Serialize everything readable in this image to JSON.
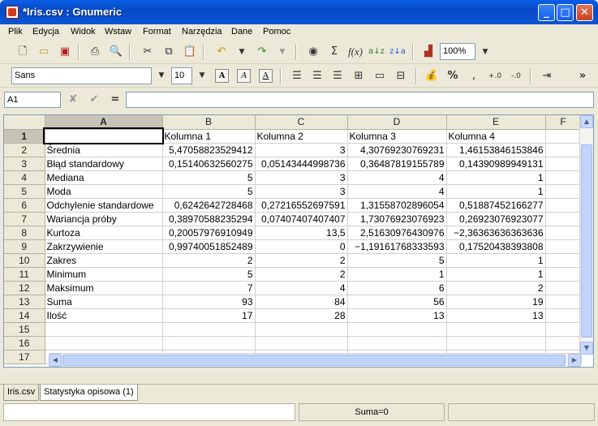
{
  "window": {
    "title": "*Iris.csv : Gnumeric"
  },
  "menu": [
    "Plik",
    "Edycja",
    "Widok",
    "Wstaw",
    "Format",
    "Narzędzia",
    "Dane",
    "Pomoc"
  ],
  "toolbar": {
    "zoom": "100%",
    "font_name": "Sans",
    "font_size": "10",
    "bold_A": "A",
    "italic_A": "A",
    "underline_A": "A",
    "percent": "%",
    "chevron": "»"
  },
  "entry": {
    "cell_ref": "A1",
    "equals": "=",
    "value": ""
  },
  "columns": [
    "A",
    "B",
    "C",
    "D",
    "E",
    "F"
  ],
  "rows": [
    {
      "n": "1",
      "a": "",
      "b": "Kolumna 1",
      "c": "Kolumna 2",
      "d": "Kolumna 3",
      "e": "Kolumna 4"
    },
    {
      "n": "2",
      "a": "Średnia",
      "b": "5,47058823529412",
      "c": "3",
      "d": "4,30769230769231",
      "e": "1,46153846153846"
    },
    {
      "n": "3",
      "a": "Błąd standardowy",
      "b": "0,15140632560275",
      "c": "0,05143444998736",
      "d": "0,36487819155789",
      "e": "0,14390989949131"
    },
    {
      "n": "4",
      "a": "Mediana",
      "b": "5",
      "c": "3",
      "d": "4",
      "e": "1"
    },
    {
      "n": "5",
      "a": "Moda",
      "b": "5",
      "c": "3",
      "d": "4",
      "e": "1"
    },
    {
      "n": "6",
      "a": "Odchylenie standardowe",
      "b": "0,6242642728468",
      "c": "0,27216552697591",
      "d": "1,31558702896054",
      "e": "0,51887452166277"
    },
    {
      "n": "7",
      "a": "Wariancja próby",
      "b": "0,38970588235294",
      "c": "0,07407407407407",
      "d": "1,73076923076923",
      "e": "0,26923076923077"
    },
    {
      "n": "8",
      "a": "Kurtoza",
      "b": "0,20057976910949",
      "c": "13,5",
      "d": "2,51630976430976",
      "e": "−2,36363636363636"
    },
    {
      "n": "9",
      "a": "Zakrzywienie",
      "b": "0,99740051852489",
      "c": "0",
      "d": "−1,19161768333593",
      "e": "0,17520438393808"
    },
    {
      "n": "10",
      "a": "Zakres",
      "b": "2",
      "c": "2",
      "d": "5",
      "e": "1"
    },
    {
      "n": "11",
      "a": "Minimum",
      "b": "5",
      "c": "2",
      "d": "1",
      "e": "1"
    },
    {
      "n": "12",
      "a": "Maksimum",
      "b": "7",
      "c": "4",
      "d": "6",
      "e": "2"
    },
    {
      "n": "13",
      "a": "Suma",
      "b": "93",
      "c": "84",
      "d": "56",
      "e": "19"
    },
    {
      "n": "14",
      "a": "Ilość",
      "b": "17",
      "c": "28",
      "d": "13",
      "e": "13"
    },
    {
      "n": "15",
      "a": "",
      "b": "",
      "c": "",
      "d": "",
      "e": ""
    },
    {
      "n": "16",
      "a": "",
      "b": "",
      "c": "",
      "d": "",
      "e": ""
    },
    {
      "n": "17",
      "a": "",
      "b": "",
      "c": "",
      "d": "",
      "e": ""
    }
  ],
  "sheets": [
    "Iris.csv",
    "Statystyka opisowa (1)"
  ],
  "status": {
    "sum": "Suma=0"
  },
  "icons": [
    "new-icon",
    "open-icon",
    "save-icon",
    "print-icon",
    "print-preview-icon",
    "cut-icon",
    "copy-icon",
    "paste-icon",
    "undo-icon",
    "redo-icon",
    "hyperlink-icon",
    "sum-icon",
    "function-icon",
    "sort-ascending-icon",
    "sort-descending-icon",
    "chart-icon"
  ]
}
